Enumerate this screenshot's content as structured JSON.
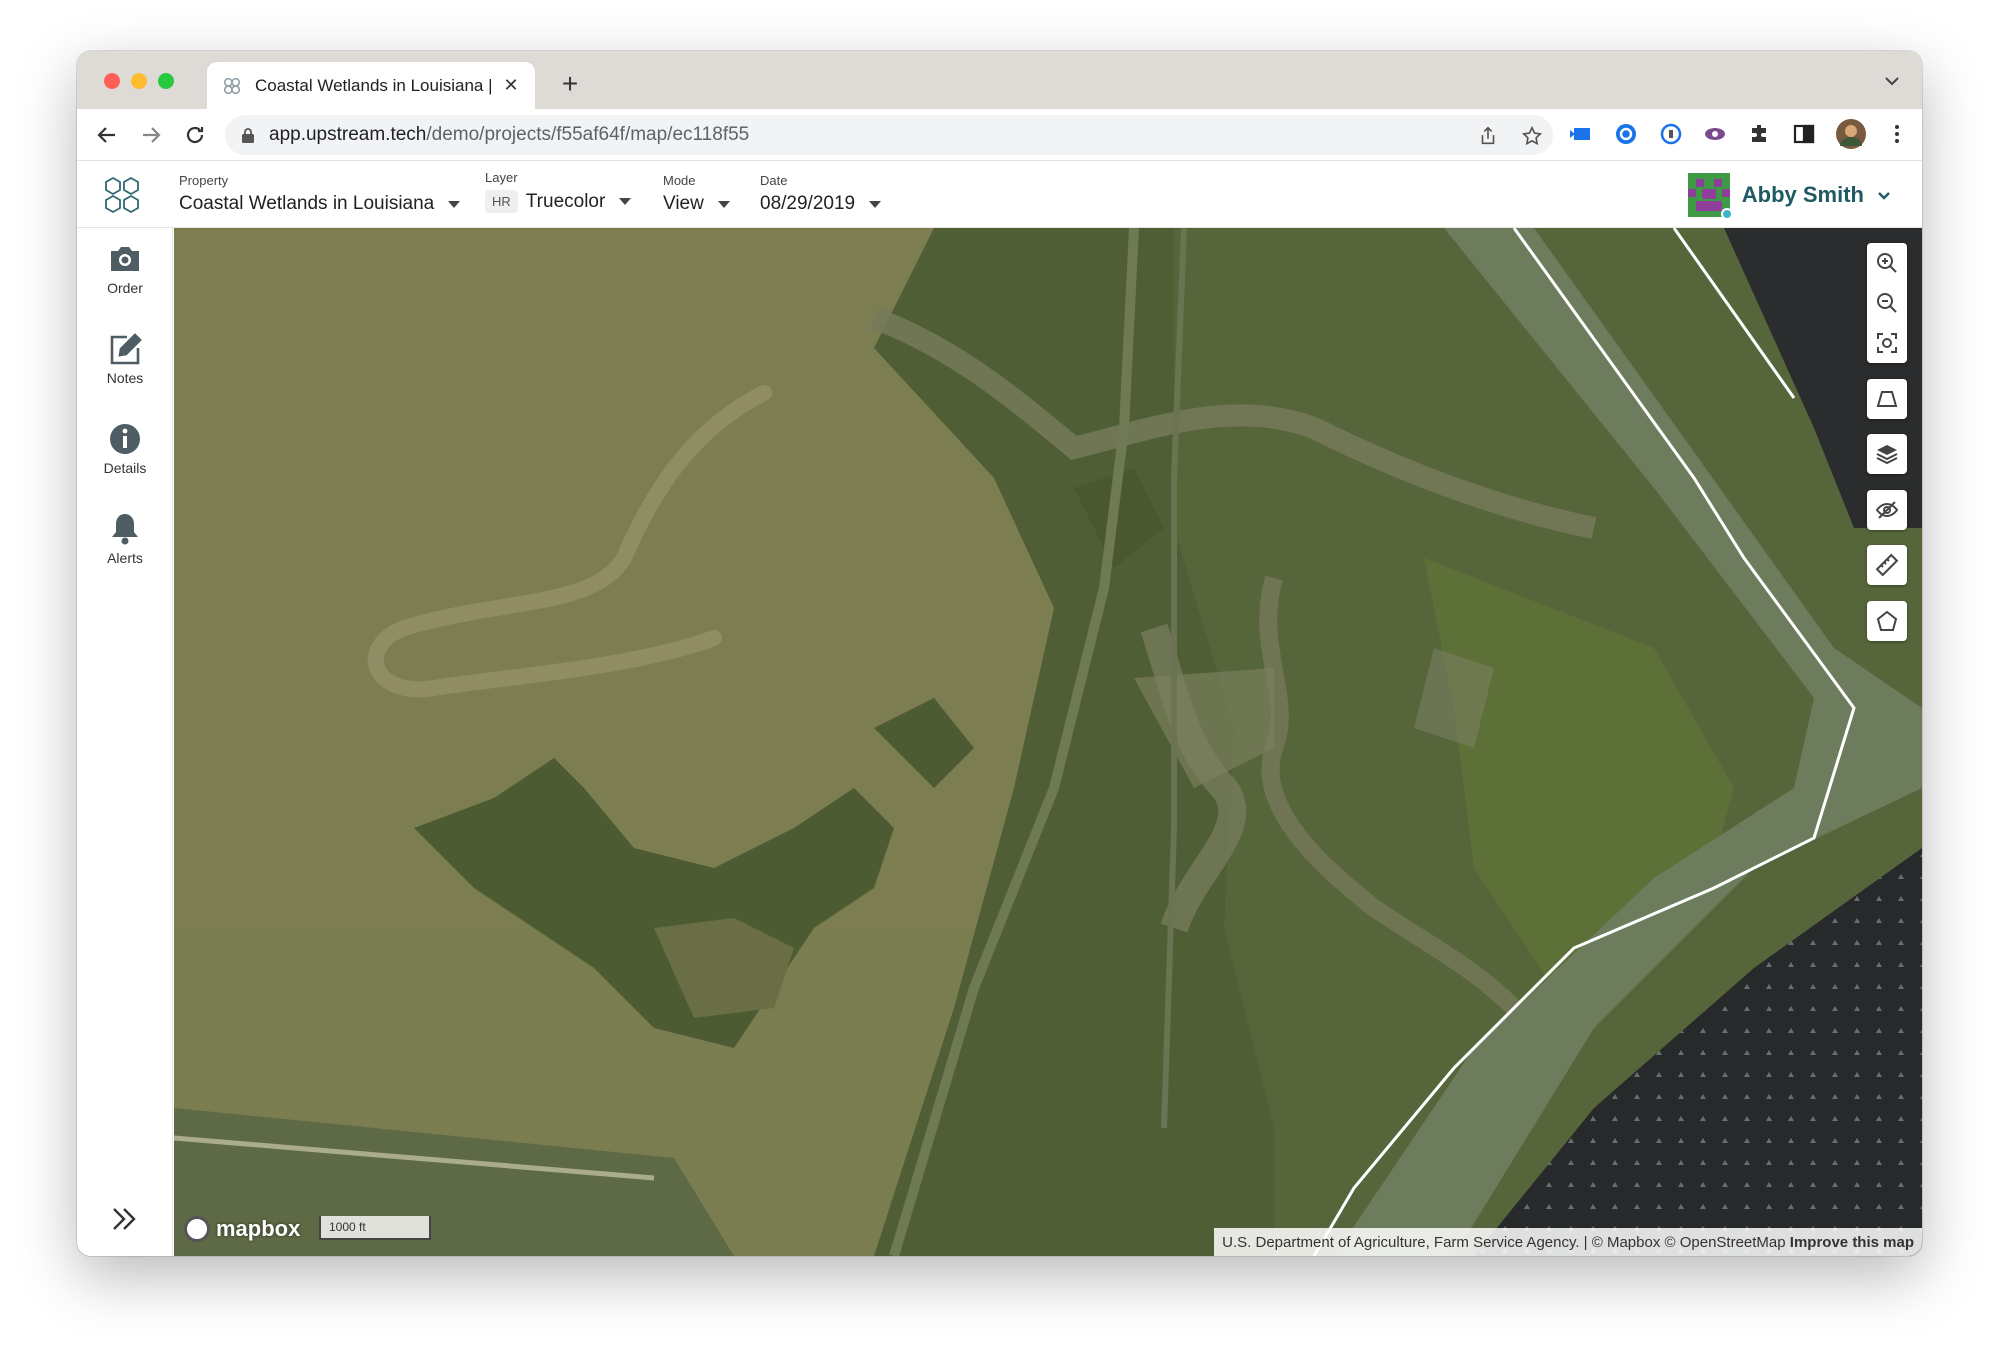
{
  "browser": {
    "tab_title": "Coastal Wetlands in Louisiana |",
    "url_host": "app.upstream.tech",
    "url_path": "/demo/projects/f55af64f/map/ec118f55"
  },
  "header": {
    "property_label": "Property",
    "property_value": "Coastal Wetlands in Louisiana",
    "layer_label": "Layer",
    "layer_badge": "HR",
    "layer_value": "Truecolor",
    "mode_label": "Mode",
    "mode_value": "View",
    "date_label": "Date",
    "date_value": "08/29/2019",
    "user_name": "Abby Smith"
  },
  "sidebar": {
    "items": [
      {
        "label": "Order",
        "icon": "camera-icon"
      },
      {
        "label": "Notes",
        "icon": "edit-icon"
      },
      {
        "label": "Details",
        "icon": "info-icon"
      },
      {
        "label": "Alerts",
        "icon": "bell-icon"
      }
    ]
  },
  "map": {
    "logo_text": "mapbox",
    "scale_label": "1000 ft",
    "attribution": "U.S. Department of Agriculture, Farm Service Agency. | © Mapbox © OpenStreetMap",
    "improve_link": "Improve this map",
    "controls": [
      "zoom-in-icon",
      "zoom-out-icon",
      "fit-bounds-icon",
      "draw-shape-icon",
      "layers-icon",
      "visibility-icon",
      "ruler-icon",
      "polygon-icon"
    ]
  },
  "colors": {
    "brand": "#1f5a63",
    "water": "#7a7d4f",
    "marsh": "#4f5e34",
    "boundary": "#ffffff"
  }
}
